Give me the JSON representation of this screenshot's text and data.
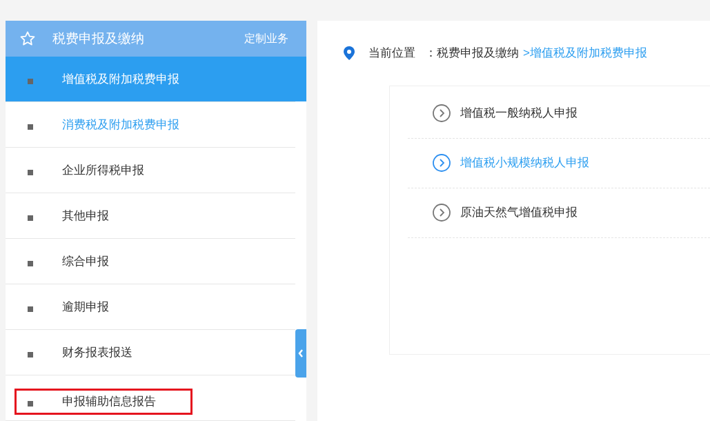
{
  "sidebar": {
    "title": "税费申报及缴纳",
    "action": "定制业务",
    "items": [
      {
        "label": "增值税及附加税费申报",
        "selected": true,
        "hovered": false,
        "outlined": false
      },
      {
        "label": "消费税及附加税费申报",
        "selected": false,
        "hovered": true,
        "outlined": false
      },
      {
        "label": "企业所得税申报",
        "selected": false,
        "hovered": false,
        "outlined": false
      },
      {
        "label": "其他申报",
        "selected": false,
        "hovered": false,
        "outlined": false
      },
      {
        "label": "综合申报",
        "selected": false,
        "hovered": false,
        "outlined": false
      },
      {
        "label": "逾期申报",
        "selected": false,
        "hovered": false,
        "outlined": false
      },
      {
        "label": "财务报表报送",
        "selected": false,
        "hovered": false,
        "outlined": false
      },
      {
        "label": "申报辅助信息报告",
        "selected": false,
        "hovered": false,
        "outlined": true
      }
    ]
  },
  "breadcrumb": {
    "label": "当前位置",
    "separator": "：",
    "parent": "税费申报及缴纳",
    "current": ">增值税及附加税费申报"
  },
  "options": [
    {
      "label": "增值税一般纳税人申报",
      "hovered": false
    },
    {
      "label": "增值税小规模纳税人申报",
      "hovered": true
    },
    {
      "label": "原油天然气增值税申报",
      "hovered": false
    }
  ]
}
